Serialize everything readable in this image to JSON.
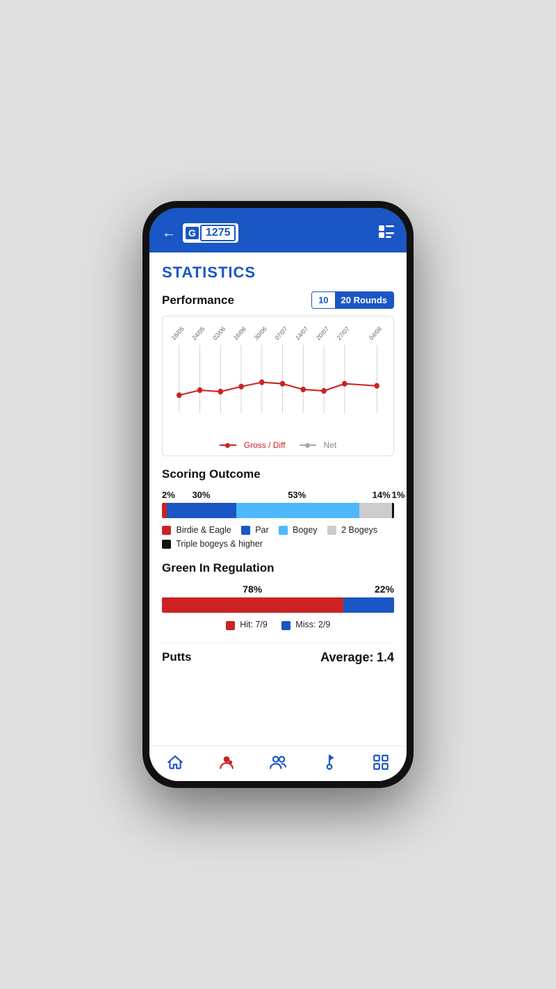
{
  "header": {
    "back_label": "←",
    "logo_letter": "G",
    "handicap": "1275",
    "menu_icon": "☰"
  },
  "page": {
    "title": "STATISTICS"
  },
  "performance": {
    "title": "Performance",
    "toggle_10": "10",
    "toggle_20": "20 Rounds",
    "dates": [
      "18/05",
      "24/05",
      "02/06",
      "16/06",
      "30/06",
      "07/07",
      "14/07",
      "20/07",
      "27/07",
      "04/08"
    ],
    "gross_data": [
      28,
      22,
      24,
      20,
      17,
      18,
      22,
      23,
      18,
      19
    ],
    "legend_gross": "Gross / Diff",
    "legend_net": "Net"
  },
  "scoring": {
    "title": "Scoring Outcome",
    "percentages": {
      "birdie_eagle": "2%",
      "par": "30%",
      "bogey": "53%",
      "two_bogeys": "14%",
      "triple": "1%"
    },
    "bars": {
      "birdie_eagle_pct": 2,
      "par_pct": 30,
      "bogey_pct": 53,
      "two_bogeys_pct": 14,
      "triple_pct": 1
    },
    "legend": [
      {
        "label": "Birdie & Eagle",
        "color": "#cc2222"
      },
      {
        "label": "Par",
        "color": "#1a56c4"
      },
      {
        "label": "Bogey",
        "color": "#4db8ff"
      },
      {
        "label": "2 Bogeys",
        "color": "#cccccc"
      },
      {
        "label": "Triple bogeys & higher",
        "color": "#111111"
      }
    ]
  },
  "gir": {
    "title": "Green In Regulation",
    "hit_pct": "78%",
    "miss_pct": "22%",
    "hit_val": 78,
    "miss_val": 22,
    "hit_label": "Hit: 7/9",
    "miss_label": "Miss: 2/9"
  },
  "putts": {
    "title": "Putts",
    "avg_label": "Average:",
    "avg_value": "1.4"
  },
  "nav": {
    "home_icon": "⌂",
    "profile_icon": "👤",
    "group_icon": "👥",
    "golf_icon": "⛳",
    "grid_icon": "⊞"
  }
}
